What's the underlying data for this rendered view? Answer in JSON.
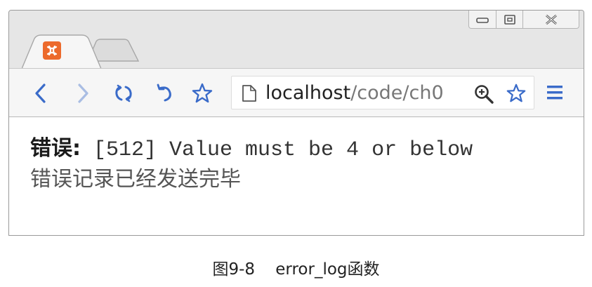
{
  "browser": {
    "tabs": [
      {
        "favicon": "xampp-favicon-icon",
        "active": true
      },
      {
        "active": false
      }
    ],
    "window_controls": [
      "minimize-icon",
      "maximize-icon",
      "close-icon"
    ],
    "toolbar": {
      "buttons": [
        "back-icon",
        "forward-icon",
        "reload-icon",
        "undo-icon",
        "bookmark-star-icon"
      ],
      "address": {
        "host": "localhost",
        "path": "/code/ch0"
      },
      "right_icons": [
        "zoom-icon",
        "star-icon",
        "menu-icon"
      ]
    },
    "colors": {
      "favicon_bg": "#ec6a2c",
      "icon_blue": "#3a6bc9"
    }
  },
  "page": {
    "error_label": "错误:",
    "error_message": " [512] Value must be 4 or below",
    "status_line": "错误记录已经发送完毕"
  },
  "caption": "图9-8    error_log函数"
}
